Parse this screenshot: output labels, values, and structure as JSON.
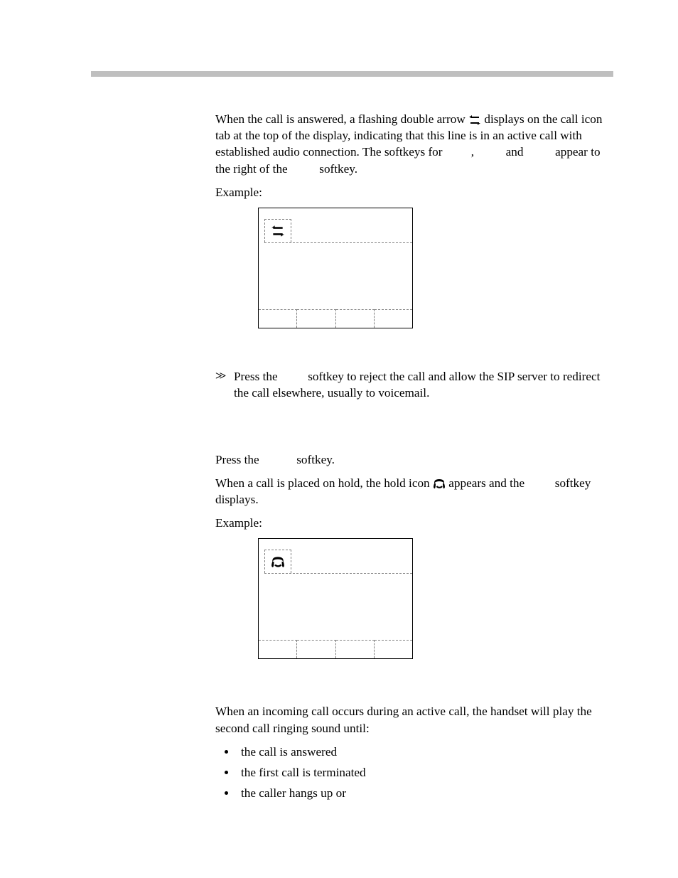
{
  "p1": {
    "t1": "When the call is answered, a flashing double arrow ",
    "t2": " displays on the call icon tab at the top of the display, indicating that this line is in an active call with established audio connection. The softkeys for ",
    "t2b": ",",
    "t3": " and ",
    "t4": " appear to the right of the ",
    "t5": " softkey."
  },
  "exampleLabel": "Example:",
  "rej": {
    "t1": "Press the ",
    "t2": " softkey to reject the call and allow the SIP server to redirect the call elsewhere, usually to voicemail."
  },
  "hold1": {
    "t1": "Press the ",
    "t2": " softkey."
  },
  "hold2": {
    "t1": "When a call is placed on hold, the hold icon ",
    "t2": " appears and the ",
    "t3": " softkey displays."
  },
  "incoming": {
    "p1": "When an incoming call occurs during an active call, the handset will play the second call ringing sound until:",
    "b1": "the call is answered",
    "b2": "the first call is terminated",
    "b3": "the caller hangs up or"
  },
  "icons": {
    "doubleArrow": "double-arrow-icon",
    "hold": "hold-icon"
  }
}
